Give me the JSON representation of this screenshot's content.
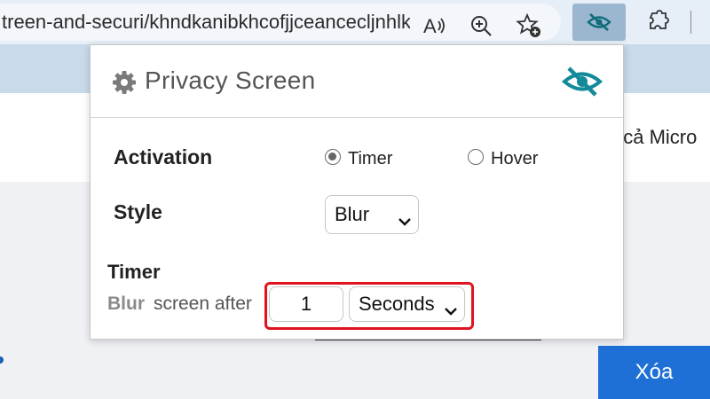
{
  "browser": {
    "url": "treen-and-securi/khndkanibkhcofjjceancecljnhlk..."
  },
  "page": {
    "bg_text": "t cả Micro",
    "delete_button": "Xóa"
  },
  "popup": {
    "title": "Privacy Screen",
    "activation_label": "Activation",
    "activation_options": [
      {
        "label": "Timer",
        "selected": true
      },
      {
        "label": "Hover",
        "selected": false
      }
    ],
    "style_label": "Style",
    "style_value": "Blur",
    "timer_title": "Timer",
    "timer_effect_word": "Blur",
    "timer_after_text": "screen after",
    "timer_value": "1",
    "timer_unit": "Seconds"
  },
  "colors": {
    "accent_teal": "#138a9a",
    "highlight_red": "#e0141e",
    "delete_blue": "#1e70d6"
  }
}
